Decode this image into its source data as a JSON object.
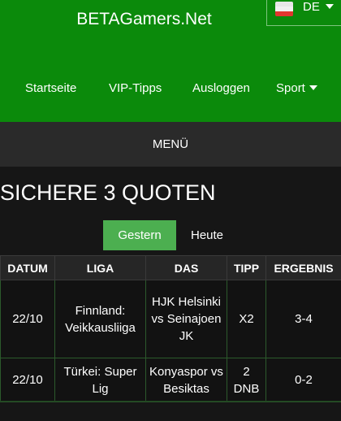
{
  "header": {
    "brand": "BETAGamers.Net",
    "language": "DE",
    "nav": [
      "Startseite",
      "VIP-Tipps",
      "Ausloggen",
      "Sport"
    ]
  },
  "menu_label": "MENÜ",
  "page_title": "SICHERE 3 QUOTEN",
  "tabs": {
    "active": "Gestern",
    "other": "Heute"
  },
  "table": {
    "headers": [
      "DATUM",
      "LIGA",
      "DAS",
      "TIPP",
      "ERGEBNIS"
    ],
    "rows": [
      {
        "date": "22/10",
        "league": "Finnland: Veikkausliiga",
        "match": "HJK Helsinki vs Seinajoen JK",
        "tip": "X2",
        "result": "3-4"
      },
      {
        "date": "22/10",
        "league": "Türkei: Super Lig",
        "match": "Konyaspor vs Besiktas",
        "tip": "2 DNB",
        "result": "0-2"
      }
    ]
  },
  "colors": {
    "header_green": "#0b8a0b",
    "tab_green": "#4caf50",
    "background": "#161616"
  }
}
